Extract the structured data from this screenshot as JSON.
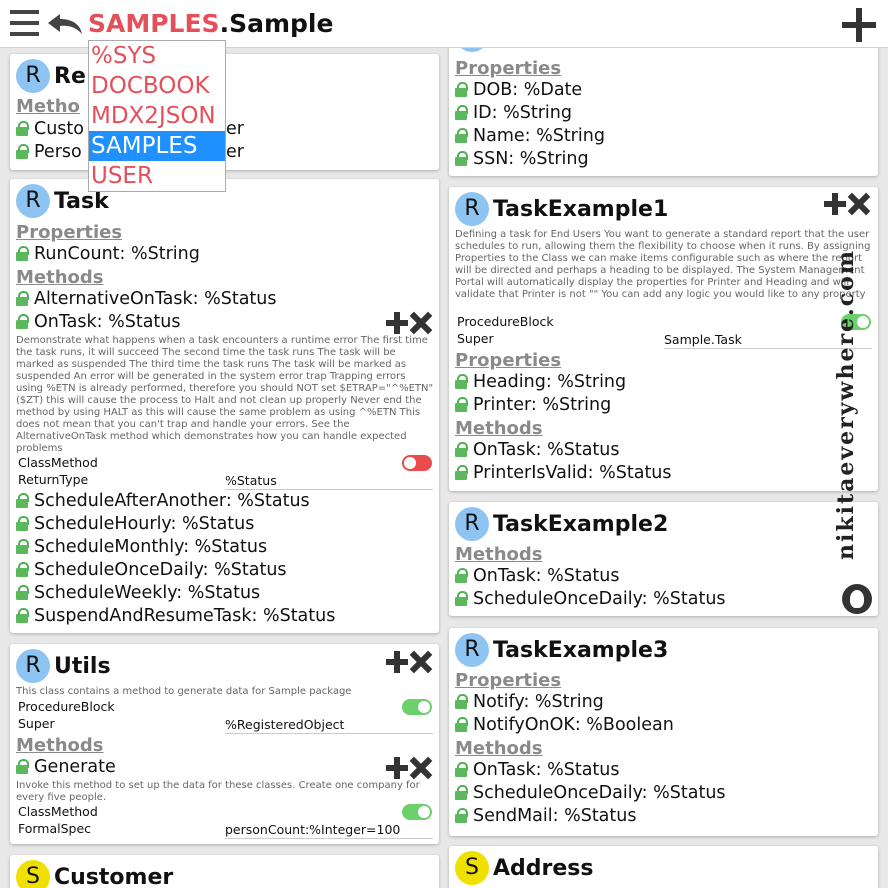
{
  "header": {
    "namespace": "SAMPLES",
    "package": ".Sample"
  },
  "namespace_dropdown": {
    "options": [
      "%SYS",
      "DOCBOOK",
      "MDX2JSON",
      "SAMPLES",
      "USER"
    ],
    "selected": "SAMPLES"
  },
  "watermark": "nikitaeverywhere.com",
  "colors": {
    "namespace": "#e4505a",
    "selected_option": "#1e90ff",
    "toggle_on": "#6cd06c",
    "toggle_off": "#e94c4c",
    "badge_r": "#8ec4f2",
    "badge_s": "#f0e000"
  },
  "cards": {
    "registry": {
      "badge": "R",
      "name": "Re",
      "methods_label": "Metho",
      "rows": [
        "Custo",
        "er",
        "Perso",
        "er"
      ]
    },
    "person_props": {
      "properties_label": "Properties",
      "properties": [
        "DOB: %Date",
        "ID: %String",
        "Name: %String",
        "SSN: %String"
      ]
    },
    "task": {
      "badge": "R",
      "name": "Task",
      "properties_label": "Properties",
      "properties": [
        "RunCount: %String"
      ],
      "methods_label": "Methods",
      "methods_top": [
        "AlternativeOnTask: %Status",
        "OnTask: %Status"
      ],
      "description": "Demonstrate what happens when a task encounters a runtime error The first time the task runs, it will succeed The second time the task runs The task will be marked as suspended The third time the task runs The task will be marked as suspended An error will be generated in the system error trap Trapping errors using %ETN is already performed, therefore you should NOT set $ETRAP=\"^%ETN\" ($ZT) this will cause the process to Halt and not clean up properly Never end the method by using HALT as this will cause the same problem as using ^%ETN This does not mean that you can't trap and handle your errors. See the AlternativeOnTask method which demonstrates how you can handle expected problems",
      "class_method_label": "ClassMethod",
      "return_type_label": "ReturnType",
      "return_type_value": "%Status",
      "methods_bottom": [
        "ScheduleAfterAnother: %Status",
        "ScheduleHourly: %Status",
        "ScheduleMonthly: %Status",
        "ScheduleOnceDaily: %Status",
        "ScheduleWeekly: %Status",
        "SuspendAndResumeTask: %Status"
      ]
    },
    "utils": {
      "badge": "R",
      "name": "Utils",
      "description": "This class contains a method to generate data for Sample package",
      "procedure_block_label": "ProcedureBlock",
      "super_label": "Super",
      "super_value": "%RegisteredObject",
      "methods_label": "Methods",
      "method": "Generate",
      "method_description": "Invoke this method to set up the data for these classes. Create one company for every five people.",
      "class_method_label": "ClassMethod",
      "formal_spec_label": "FormalSpec",
      "formal_spec_value": "personCount:%Integer=100"
    },
    "customer": {
      "badge": "S",
      "name": "Customer"
    },
    "task_example1": {
      "badge": "R",
      "name": "TaskExample1",
      "description": "Defining a task for End Users You want to generate a standard report that the user schedules to run, allowing them the flexibility to choose when it runs. By assigning Properties to the Class we can make items configurable such as where the report will be directed and perhaps a heading to be displayed. The System Management Portal will automatically display the properties for Printer and Heading and will validate that Printer is not \"\" You can add any logic you would like to any property",
      "procedure_block_label": "ProcedureBlock",
      "super_label": "Super",
      "super_value": "Sample.Task",
      "properties_label": "Properties",
      "properties": [
        "Heading: %String",
        "Printer: %String"
      ],
      "methods_label": "Methods",
      "methods": [
        "OnTask: %Status",
        "PrinterIsValid: %Status"
      ]
    },
    "task_example2": {
      "badge": "R",
      "name": "TaskExample2",
      "methods_label": "Methods",
      "methods": [
        "OnTask: %Status",
        "ScheduleOnceDaily: %Status"
      ]
    },
    "task_example3": {
      "badge": "R",
      "name": "TaskExample3",
      "properties_label": "Properties",
      "properties": [
        "Notify: %String",
        "NotifyOnOK: %Boolean"
      ],
      "methods_label": "Methods",
      "methods": [
        "OnTask: %Status",
        "ScheduleOnceDaily: %Status",
        "SendMail: %Status"
      ]
    },
    "address": {
      "badge": "S",
      "name": "Address"
    }
  }
}
